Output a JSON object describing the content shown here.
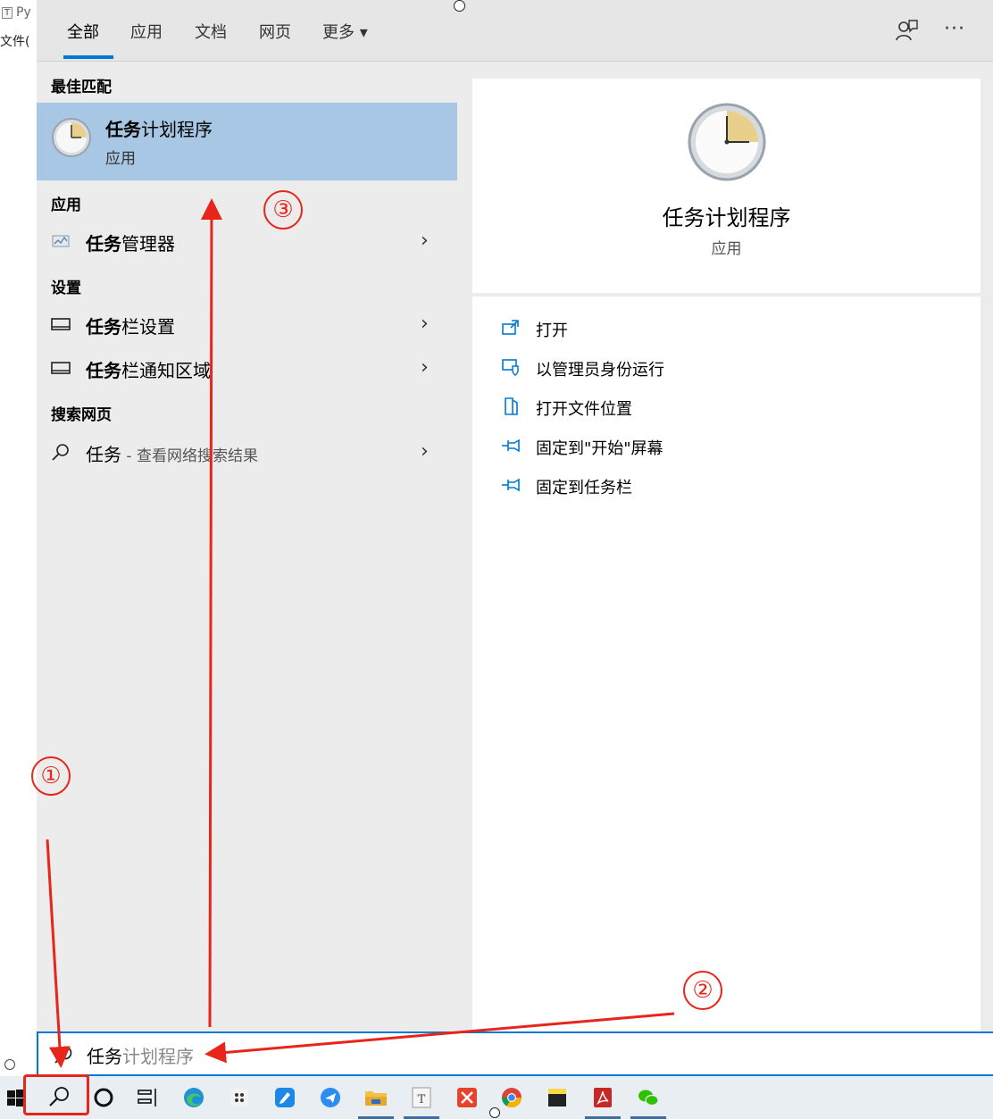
{
  "background_app": {
    "tab_title": "Py",
    "menu_label": "文件("
  },
  "tabs": [
    {
      "label": "全部",
      "active": true
    },
    {
      "label": "应用",
      "active": false
    },
    {
      "label": "文档",
      "active": false
    },
    {
      "label": "网页",
      "active": false
    },
    {
      "label": "更多 ▾",
      "active": false
    }
  ],
  "top_bar": {
    "more_options": "···"
  },
  "results": {
    "best_match_heading": "最佳匹配",
    "best_match": {
      "title_bold": "任务",
      "title_rest": "计划程序",
      "subtitle": "应用"
    },
    "apps_heading": "应用",
    "apps": [
      {
        "bold": "任务",
        "rest": "管理器"
      }
    ],
    "settings_heading": "设置",
    "settings": [
      {
        "bold": "任务",
        "rest": "栏设置"
      },
      {
        "bold": "任务",
        "rest": "栏通知区域"
      }
    ],
    "web_heading": "搜索网页",
    "web": {
      "bold": "任务",
      "hint": " - 查看网络搜索结果"
    },
    "chevron": "›"
  },
  "preview": {
    "title": "任务计划程序",
    "subtitle": "应用",
    "actions": [
      {
        "label": "打开",
        "icon": "open-window-icon"
      },
      {
        "label": "以管理员身份运行",
        "icon": "shield-window-icon"
      },
      {
        "label": "打开文件位置",
        "icon": "file-location-icon"
      },
      {
        "label": "固定到\"开始\"屏幕",
        "icon": "pin-icon"
      },
      {
        "label": "固定到任务栏",
        "icon": "pin-icon"
      }
    ]
  },
  "search": {
    "typed": "任务",
    "suggestion": "计划程序"
  },
  "annotations": {
    "step1": "①",
    "step2": "②",
    "step3": "③",
    "color": "#e8251a"
  },
  "accent_color": "#0078d4",
  "taskbar_icons": [
    "windows-start-icon",
    "search-icon",
    "cortana-icon",
    "task-view-icon",
    "edge-icon",
    "app-grid-icon",
    "blue-note-icon",
    "blue-chat-icon",
    "file-explorer-icon",
    "typora-icon",
    "xmind-icon",
    "chrome-icon",
    "sticky-notes-icon",
    "acrobat-icon",
    "wechat-icon"
  ]
}
